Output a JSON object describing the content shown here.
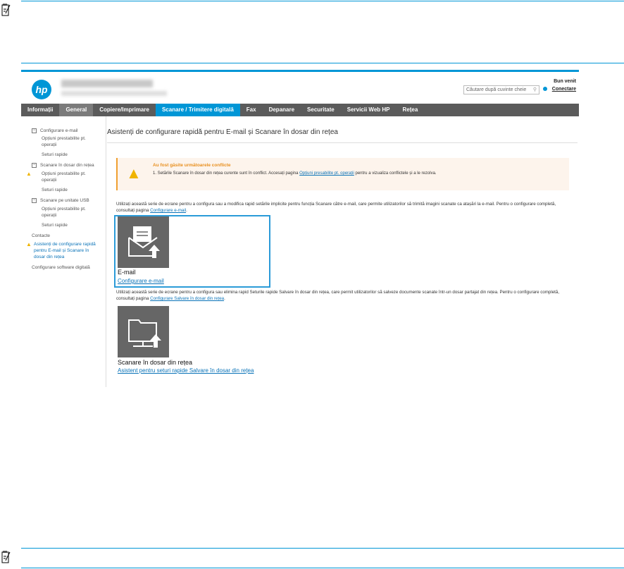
{
  "ews": {
    "logo": "hp",
    "search_placeholder": "Căutare după cuvinte cheie",
    "welcome": "Bun venit",
    "login": "Conectare",
    "nav": [
      "Informații",
      "General",
      "Copiere/Imprimare",
      "Scanare / Trimitere digitală",
      "Fax",
      "Depanare",
      "Securitate",
      "Servicii Web HP",
      "Rețea"
    ],
    "sidebar": {
      "email": "Configurare e-mail",
      "email_opts": "Opțiuni prestabilite pt. operații",
      "email_quick": "Seturi rapide",
      "folder": "Scanare în dosar din rețea",
      "folder_opts": "Opțiuni prestabilite pt. operații",
      "folder_quick": "Seturi rapide",
      "usb": "Scanare pe unitate USB",
      "usb_opts": "Opțiuni prestabilite pt. operații",
      "usb_quick": "Seturi rapide",
      "contacts": "Contacte",
      "wizard": "Asistenți de configurare rapidă pentru E-mail și Scanare în dosar din rețea",
      "software": "Configurare software digitală"
    },
    "title": "Asistenți de configurare rapidă pentru E-mail și Scanare în dosar din rețea",
    "alert": {
      "heading": "Au fost găsite următoarele conflicte",
      "text1": "1.  Setările Scanare în dosar din rețea curente sunt în conflict. Accesați pagina ",
      "link": "Opțiuni presabilite pt. operații",
      "text2": " pentru a vizualiza conflictele și a le rezolva."
    },
    "email_para": "Utilizați această serie de ecrane pentru a configura sau a modifica rapid setările implicite pentru funcția Scanare către e-mail, care permite utilizatorilor să trimită imagini scanate ca atașări la e-mail. Pentru o configurare completă, consultați pagina ",
    "email_para_link": "Configurare e-mail",
    "email_title": "E-mail",
    "email_link": "Configurare e-mail",
    "folder_para": "Utilizați această serie de ecrane pentru a configura sau elimina rapid Seturile rapide Salvare în dosar din rețea, care permit utilizatorilor să salveze documente scanate într-un dosar partajat din rețea. Pentru o configurare completă, consultați pagina ",
    "folder_para_link": "Configurare Salvare în dosar din rețea",
    "folder_title": "Scanare în dosar din rețea",
    "folder_link": "Asistent pentru seturi rapide Salvare în dosar din rețea"
  }
}
